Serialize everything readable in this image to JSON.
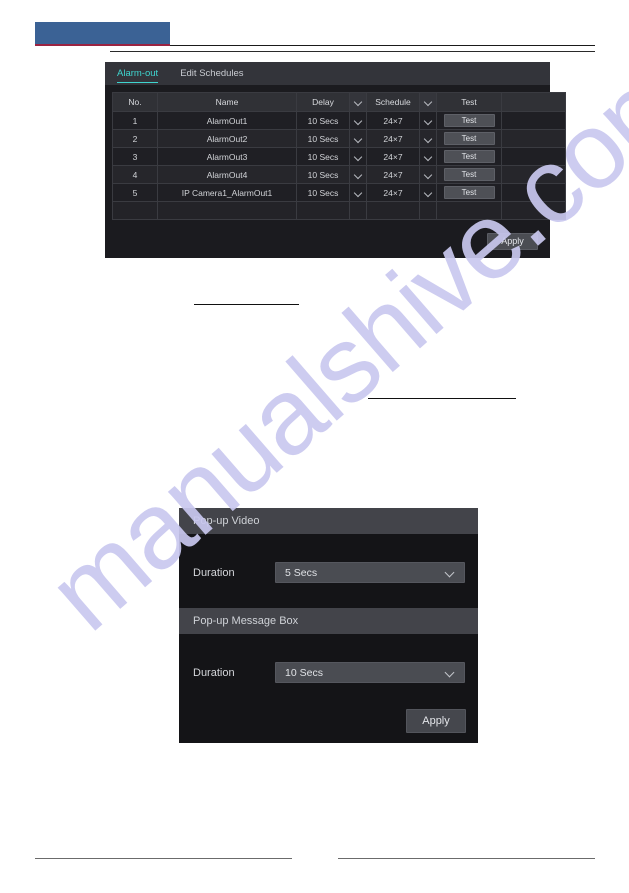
{
  "watermark": {
    "text": "manualshive.com"
  },
  "alarm_out_panel": {
    "tabs": [
      {
        "label": "Alarm-out",
        "active": true
      },
      {
        "label": "Edit Schedules",
        "active": false
      }
    ],
    "table": {
      "columns": [
        "No.",
        "Name",
        "Delay",
        "Schedule",
        "Test"
      ],
      "rows": [
        {
          "no": "1",
          "name": "AlarmOut1",
          "delay": "10 Secs",
          "schedule": "24×7",
          "test": "Test"
        },
        {
          "no": "2",
          "name": "AlarmOut2",
          "delay": "10 Secs",
          "schedule": "24×7",
          "test": "Test"
        },
        {
          "no": "3",
          "name": "AlarmOut3",
          "delay": "10 Secs",
          "schedule": "24×7",
          "test": "Test"
        },
        {
          "no": "4",
          "name": "AlarmOut4",
          "delay": "10 Secs",
          "schedule": "24×7",
          "test": "Test"
        },
        {
          "no": "5",
          "name": "IP Camera1_AlarmOut1",
          "delay": "10 Secs",
          "schedule": "24×7",
          "test": "Test"
        }
      ]
    },
    "apply_label": "Apply"
  },
  "popup_panel": {
    "video_section": {
      "title": "Pop-up Video",
      "duration_label": "Duration",
      "duration_value": "5 Secs"
    },
    "message_section": {
      "title": "Pop-up Message Box",
      "duration_label": "Duration",
      "duration_value": "10 Secs"
    },
    "apply_label": "Apply"
  },
  "colors": {
    "accent_tab": "#3fd5cf",
    "header_band": "#3b6295",
    "header_accent": "#9b2342",
    "panel_bg": "#1b1b1f",
    "watermark": "#c9c8ef"
  }
}
